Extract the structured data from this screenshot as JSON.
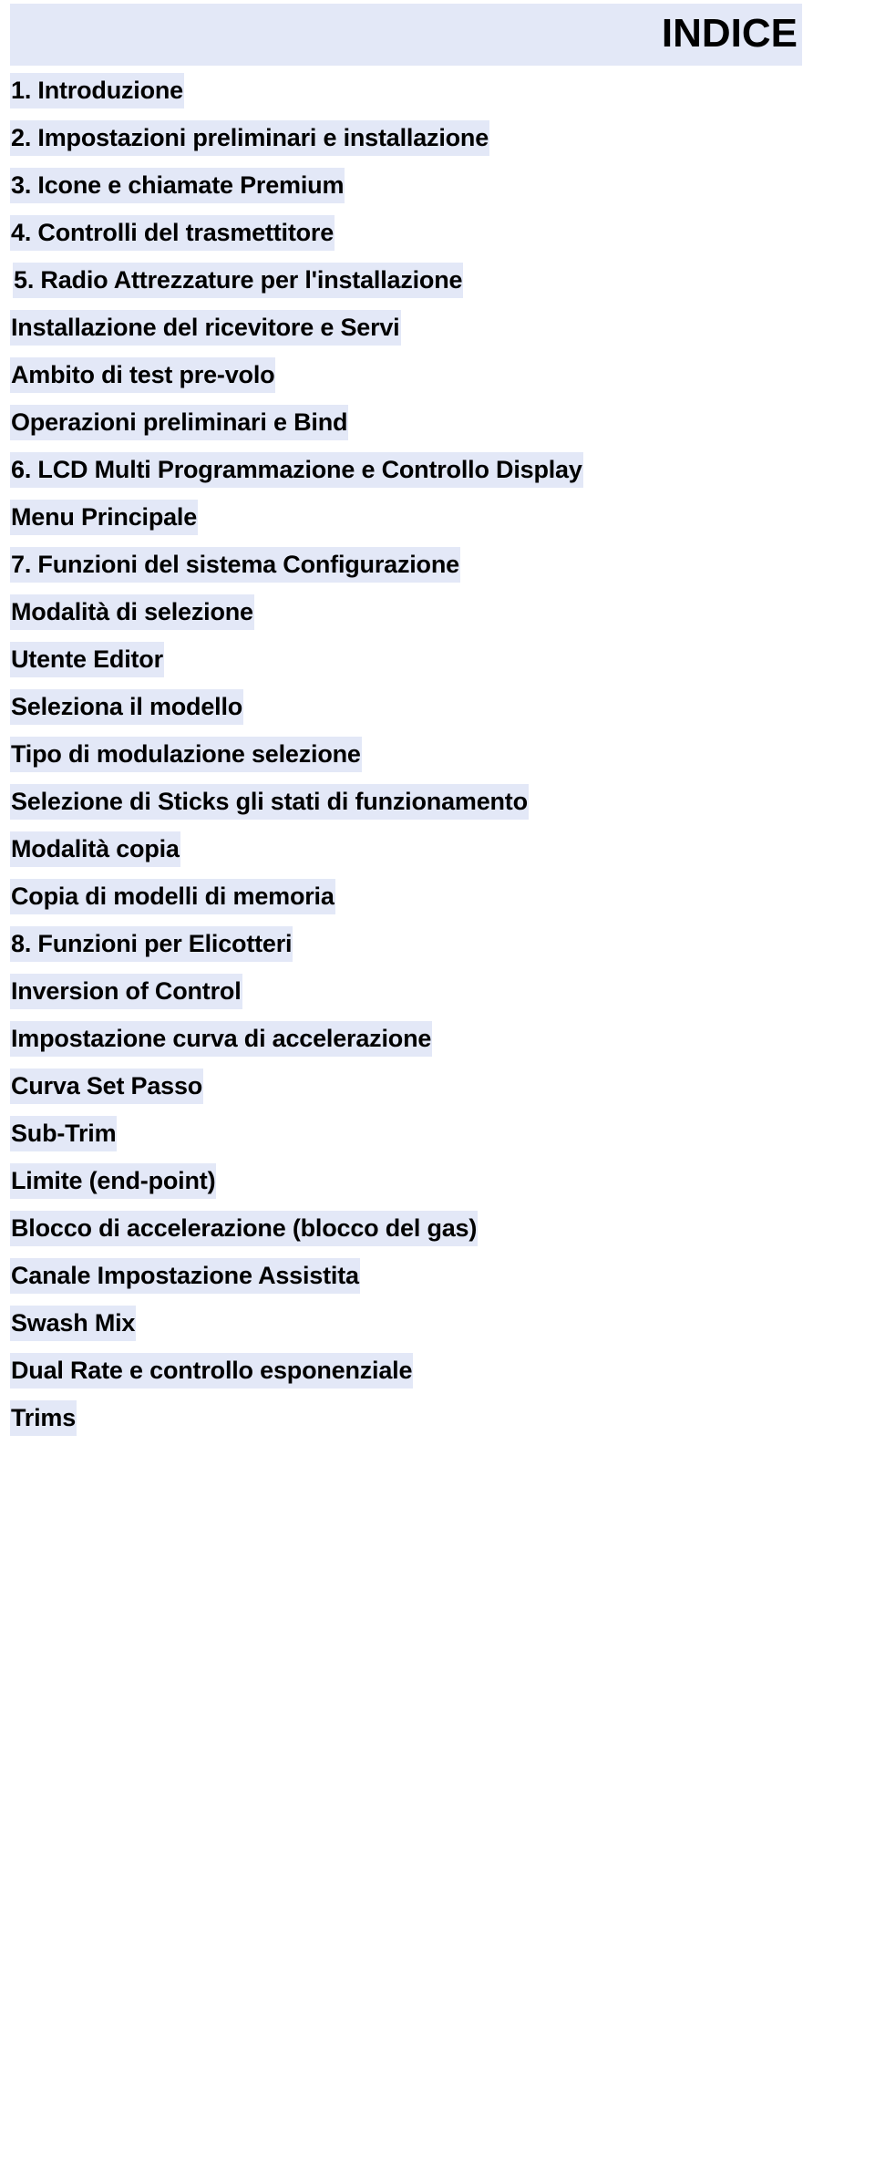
{
  "document": {
    "title": "INDICE",
    "highlight_color": "#e3e8f7",
    "text_color": "#000000",
    "page_background": "#ffffff"
  },
  "toc": {
    "heading": "INDICE",
    "entries": [
      {
        "label": "1. Introduzione",
        "level": 0
      },
      {
        "label": "2. Impostazioni preliminari e installazione",
        "level": 0
      },
      {
        "label": "3. Icone e chiamate Premium",
        "level": 0
      },
      {
        "label": "4. Controlli del trasmettitore",
        "level": 0
      },
      {
        "label": "5. Radio Attrezzature per l'installazione",
        "level": 5
      },
      {
        "label": "Installazione del ricevitore e Servi",
        "level": 1
      },
      {
        "label": "Ambito di test pre-volo",
        "level": 1
      },
      {
        "label": "Operazioni preliminari e Bind",
        "level": 1
      },
      {
        "label": "6. LCD Multi Programmazione e Controllo Display",
        "level": 0
      },
      {
        "label": "Menu Principale",
        "level": 1
      },
      {
        "label": "7. Funzioni del sistema Configurazione",
        "level": 0
      },
      {
        "label": "Modalità di selezione",
        "level": 1
      },
      {
        "label": "Utente Editor",
        "level": 1
      },
      {
        "label": "Seleziona il modello",
        "level": 1
      },
      {
        "label": "Tipo di modulazione selezione",
        "level": 1
      },
      {
        "label": "Selezione di Sticks gli stati di funzionamento",
        "level": 1
      },
      {
        "label": "Modalità copia",
        "level": 1
      },
      {
        "label": "Copia di modelli di memoria",
        "level": 1
      },
      {
        "label": "8. Funzioni per Elicotteri",
        "level": 0
      },
      {
        "label": "Inversion of Control",
        "level": 1
      },
      {
        "label": "Impostazione curva di accelerazione",
        "level": 1
      },
      {
        "label": "Curva Set Passo",
        "level": 1
      },
      {
        "label": "Sub-Trim",
        "level": 1
      },
      {
        "label": "Limite (end-point)",
        "level": 1
      },
      {
        "label": "Blocco di accelerazione (blocco del gas)",
        "level": 1
      },
      {
        "label": "Canale Impostazione Assistita",
        "level": 1
      },
      {
        "label": "Swash Mix",
        "level": 1
      },
      {
        "label": "Dual Rate e controllo esponenziale",
        "level": 1
      },
      {
        "label": "Trims",
        "level": 1
      }
    ]
  }
}
